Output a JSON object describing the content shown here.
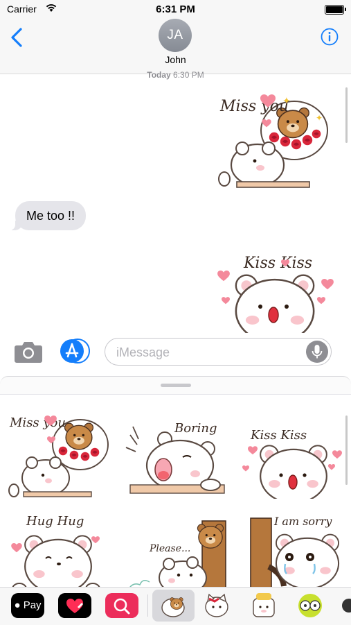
{
  "status_bar": {
    "carrier": "Carrier",
    "time": "6:31 PM"
  },
  "nav": {
    "avatar_initials": "JA",
    "contact_name": "John",
    "back_icon": "chevron-left-icon",
    "info_icon": "info-circle-icon"
  },
  "conversation": {
    "timestamp_day": "Today",
    "timestamp_time": "6:30 PM",
    "messages": [
      {
        "type": "sticker",
        "direction": "outgoing",
        "text": "Miss you"
      },
      {
        "type": "text",
        "direction": "incoming",
        "text": "Me too !!"
      },
      {
        "type": "sticker",
        "direction": "outgoing",
        "text": "Kiss Kiss"
      }
    ]
  },
  "input": {
    "placeholder": "iMessage",
    "camera_icon": "camera-icon",
    "appstore_icon": "app-store-icon",
    "mic_icon": "microphone-icon"
  },
  "sticker_drawer": {
    "stickers": [
      {
        "label": "Miss you"
      },
      {
        "label": "Boring"
      },
      {
        "label": "Kiss Kiss"
      },
      {
        "label": "Hug Hug"
      },
      {
        "label": "Please..."
      },
      {
        "label": "I am sorry"
      }
    ]
  },
  "app_strip": {
    "apple_pay_label": "Pay",
    "apps": [
      "apple-pay-icon",
      "digital-touch-icon",
      "web-search-icon",
      "bear-sticker-pack-icon",
      "cat-sticker-pack-icon",
      "bear-chef-sticker-pack-icon",
      "girl-sticker-pack-icon",
      "couple-sticker-pack-icon"
    ]
  },
  "colors": {
    "accent": "#147efb",
    "bubble_gray": "#e5e5ea",
    "heart_pink": "#f4899b",
    "bear_brown": "#b5773c",
    "rose_red": "#d8263a"
  }
}
